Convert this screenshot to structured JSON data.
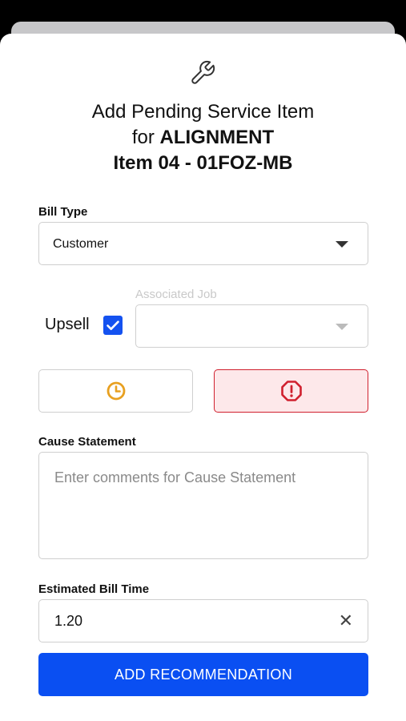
{
  "header": {
    "icon": "wrench-icon",
    "title_line1": "Add Pending Service Item",
    "title_for": "for",
    "title_service": "ALIGNMENT",
    "title_line3": "Item 04 - 01FOZ-MB"
  },
  "bill_type": {
    "label": "Bill Type",
    "value": "Customer"
  },
  "upsell": {
    "label": "Upsell",
    "checked": true
  },
  "associated_job": {
    "label": "Associated Job",
    "value": ""
  },
  "priority_buttons": [
    {
      "icon": "clock-icon",
      "color": "#e8a020"
    },
    {
      "icon": "alert-octagon-icon",
      "color": "#d0202e",
      "selected": true
    }
  ],
  "cause_statement": {
    "label": "Cause Statement",
    "placeholder": "Enter comments for Cause Statement"
  },
  "estimated_bill_time": {
    "label": "Estimated Bill Time",
    "value": "1.20"
  },
  "submit": {
    "label": "ADD RECOMMENDATION"
  },
  "colors": {
    "primary": "#0a4ff2",
    "warning": "#e8a020",
    "danger": "#d0202e",
    "danger_bg": "#fde8ea"
  }
}
